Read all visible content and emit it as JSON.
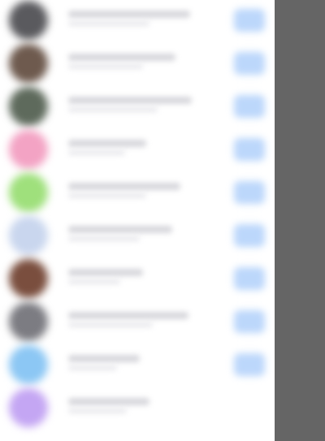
{
  "list": {
    "items": [
      {
        "avatar_color": "#5a5a5e",
        "has_action": true,
        "action_color": "#bcd7fb"
      },
      {
        "avatar_color": "#6e5a4e",
        "has_action": true,
        "action_color": "#bcd7fb"
      },
      {
        "avatar_color": "#5e6a5c",
        "has_action": true,
        "action_color": "#bcd7fb"
      },
      {
        "avatar_color": "#f3a3c4",
        "has_action": true,
        "action_color": "#bcd7fb"
      },
      {
        "avatar_color": "#9fe07c",
        "has_action": true,
        "action_color": "#bcd7fb"
      },
      {
        "avatar_color": "#c9d6ee",
        "has_action": true,
        "action_color": "#bcd7fb"
      },
      {
        "avatar_color": "#7a4e3e",
        "has_action": true,
        "action_color": "#bcd7fb"
      },
      {
        "avatar_color": "#7c7c82",
        "has_action": true,
        "action_color": "#bcd7fb"
      },
      {
        "avatar_color": "#8cc7f4",
        "has_action": true,
        "action_color": "#bcd7fb"
      },
      {
        "avatar_color": "#c4a6f3",
        "has_action": false,
        "action_color": "#bcd7fb"
      }
    ]
  },
  "overlay": {
    "color": "#656565"
  }
}
